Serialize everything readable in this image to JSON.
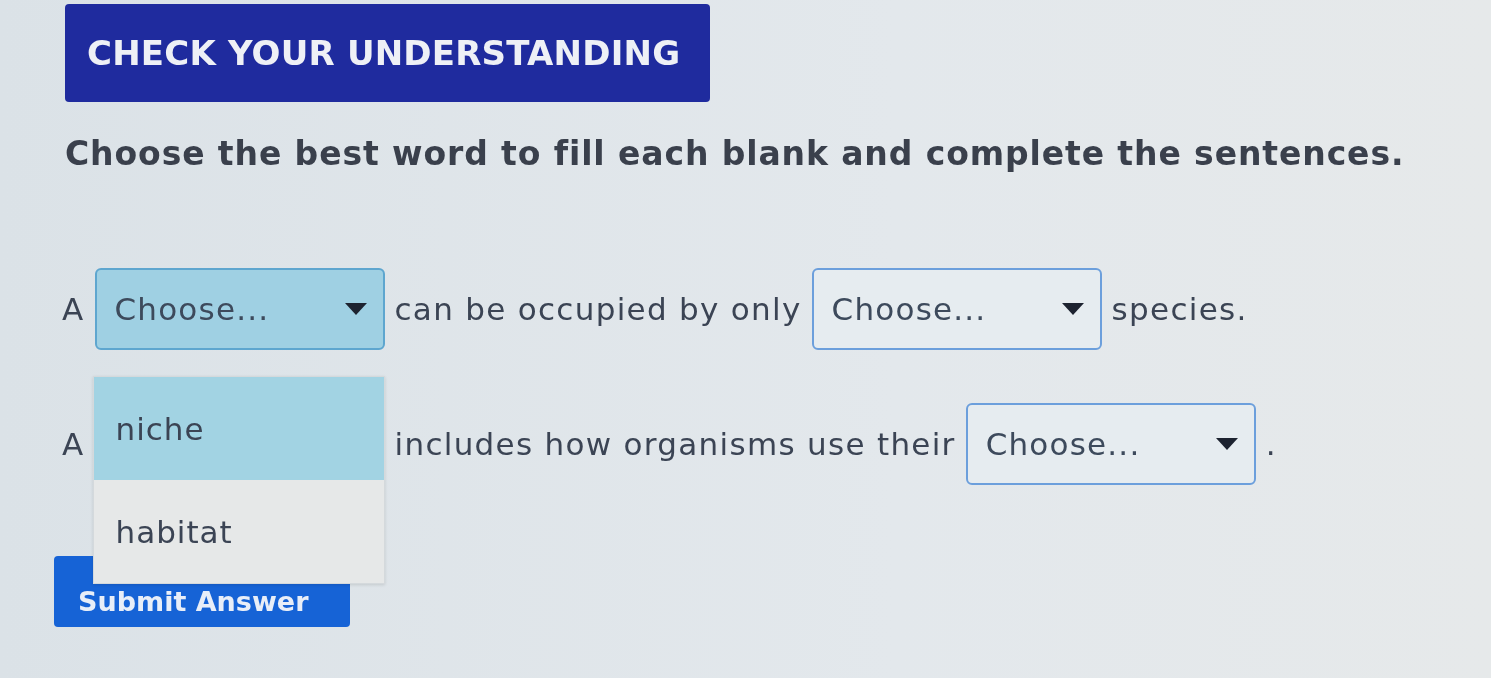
{
  "header": {
    "title": "CHECK YOUR UNDERSTANDING"
  },
  "instructions": "Choose the best word to fill each blank and complete the sentences.",
  "sentences": [
    {
      "parts": [
        {
          "kind": "text",
          "text": "A"
        },
        {
          "kind": "dropdown",
          "value": "Choose...",
          "open": true,
          "options": [
            {
              "label": "niche",
              "highlighted": true
            },
            {
              "label": "habitat",
              "highlighted": false
            }
          ]
        },
        {
          "kind": "text",
          "text": "can be occupied by only"
        },
        {
          "kind": "dropdown",
          "value": "Choose...",
          "open": false
        },
        {
          "kind": "text",
          "text": "species."
        }
      ]
    },
    {
      "parts": [
        {
          "kind": "text",
          "text": "A"
        },
        {
          "kind": "covered"
        },
        {
          "kind": "text",
          "text": "includes how organisms use their"
        },
        {
          "kind": "dropdown",
          "value": "Choose...",
          "open": false
        },
        {
          "kind": "text",
          "text": "."
        }
      ]
    }
  ],
  "submit_button": {
    "label": "Submit Answer"
  }
}
